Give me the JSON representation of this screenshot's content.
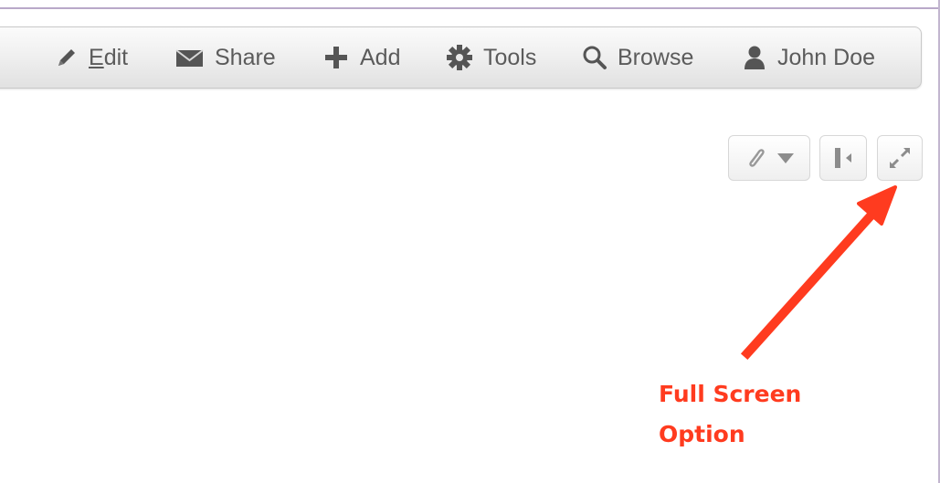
{
  "toolbar": {
    "edit_label": "Edit",
    "share_label": "Share",
    "add_label": "Add",
    "tools_label": "Tools",
    "browse_label": "Browse",
    "user_label": "John Doe"
  },
  "panel": {
    "attachment_icon": "paperclip-icon",
    "collapse_icon": "collapse-left-icon",
    "fullscreen_icon": "fullscreen-icon"
  },
  "annotation": {
    "line1": "Full Screen",
    "line2": "Option",
    "color": "#ff3b1f"
  }
}
